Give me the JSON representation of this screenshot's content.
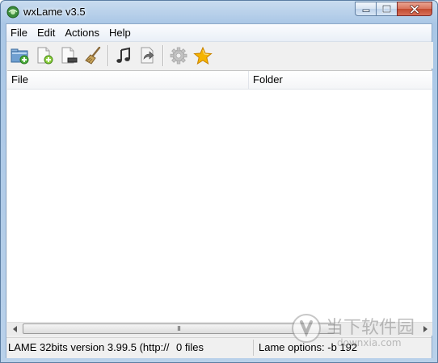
{
  "window": {
    "title": "wxLame v3.5",
    "icon": "wxlame-app-icon"
  },
  "menu": {
    "items": [
      "File",
      "Edit",
      "Actions",
      "Help"
    ]
  },
  "toolbar": {
    "buttons": [
      {
        "name": "add-folder-button",
        "icon": "folder-add-icon"
      },
      {
        "name": "add-file-button",
        "icon": "file-add-icon"
      },
      {
        "name": "remove-file-button",
        "icon": "file-remove-icon"
      },
      {
        "name": "clear-list-button",
        "icon": "broom-icon"
      },
      {
        "name": "encode-button",
        "icon": "music-note-icon"
      },
      {
        "name": "export-button",
        "icon": "export-arrow-icon"
      },
      {
        "name": "settings-button",
        "icon": "gear-icon"
      },
      {
        "name": "favorite-button",
        "icon": "star-icon"
      }
    ]
  },
  "list": {
    "columns": [
      "File",
      "Folder"
    ],
    "rows": []
  },
  "scrollbar": {
    "grip": "III"
  },
  "status": {
    "version": "LAME 32bits version 3.99.5 (http://",
    "file_count": "0 files",
    "options": "Lame options: -b 192"
  },
  "watermark": {
    "text": "当下软件园",
    "url": "downxia.com"
  },
  "colors": {
    "accent_blue": "#aac7e6",
    "close_red": "#c24a2e",
    "star_gold": "#f5b400"
  }
}
